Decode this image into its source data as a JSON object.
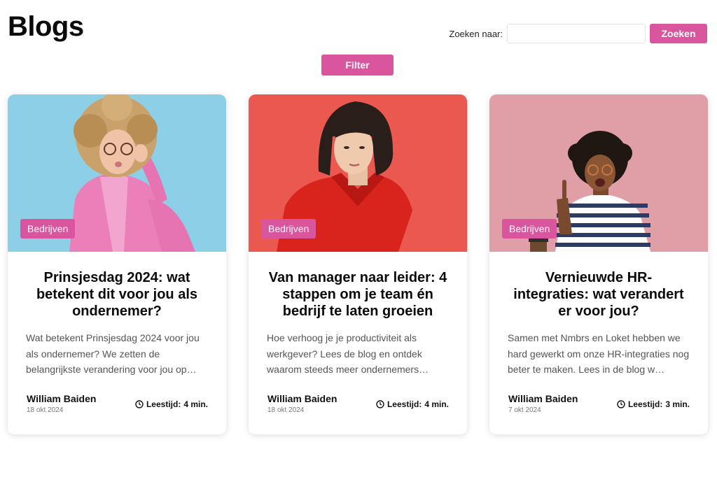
{
  "page": {
    "title": "Blogs"
  },
  "search": {
    "label": "Zoeken naar:",
    "value": "",
    "placeholder": "",
    "button_label": "Zoeken"
  },
  "filter": {
    "label": "Filter"
  },
  "colors": {
    "accent": "#d9569e"
  },
  "cards": [
    {
      "category": "Bedrijven",
      "title": "Prinsjesdag 2024: wat betekent dit voor jou als ondernemer?",
      "excerpt": "Wat betekent Prinsjesdag 2024 voor jou als ondernemer? We zetten de belangrijkste verandering voor jou op…",
      "author": "William Baiden",
      "date": "18 okt 2024",
      "read_label": "Leestijd:",
      "read_value": "4 min.",
      "image": {
        "background": "#8ecfe8",
        "subject": "woman with curly hair in pink blazer adjusting glasses"
      }
    },
    {
      "category": "Bedrijven",
      "title": "Van manager naar leider: 4 stappen om je team én bedrijf te laten groeien",
      "excerpt": "Hoe verhoog je je productiviteit als werkgever? Lees de blog en ontdek waarom steeds meer ondernemers…",
      "author": "William Baiden",
      "date": "18 okt 2024",
      "read_label": "Leestijd:",
      "read_value": "4 min.",
      "image": {
        "background": "#ea5850",
        "subject": "woman with dark bob in red shirt"
      }
    },
    {
      "category": "Bedrijven",
      "title": "Vernieuwde HR-integraties: wat verandert er voor jou?",
      "excerpt": "Samen met Nmbrs en Loket hebben we hard gewerkt om onze HR-integraties nog beter te maken. Lees in de blog w…",
      "author": "William Baiden",
      "date": "7 okt 2024",
      "read_label": "Leestijd:",
      "read_value": "3 min.",
      "image": {
        "background": "#e09fa6",
        "subject": "woman in striped shirt pointing up with idea"
      }
    }
  ]
}
